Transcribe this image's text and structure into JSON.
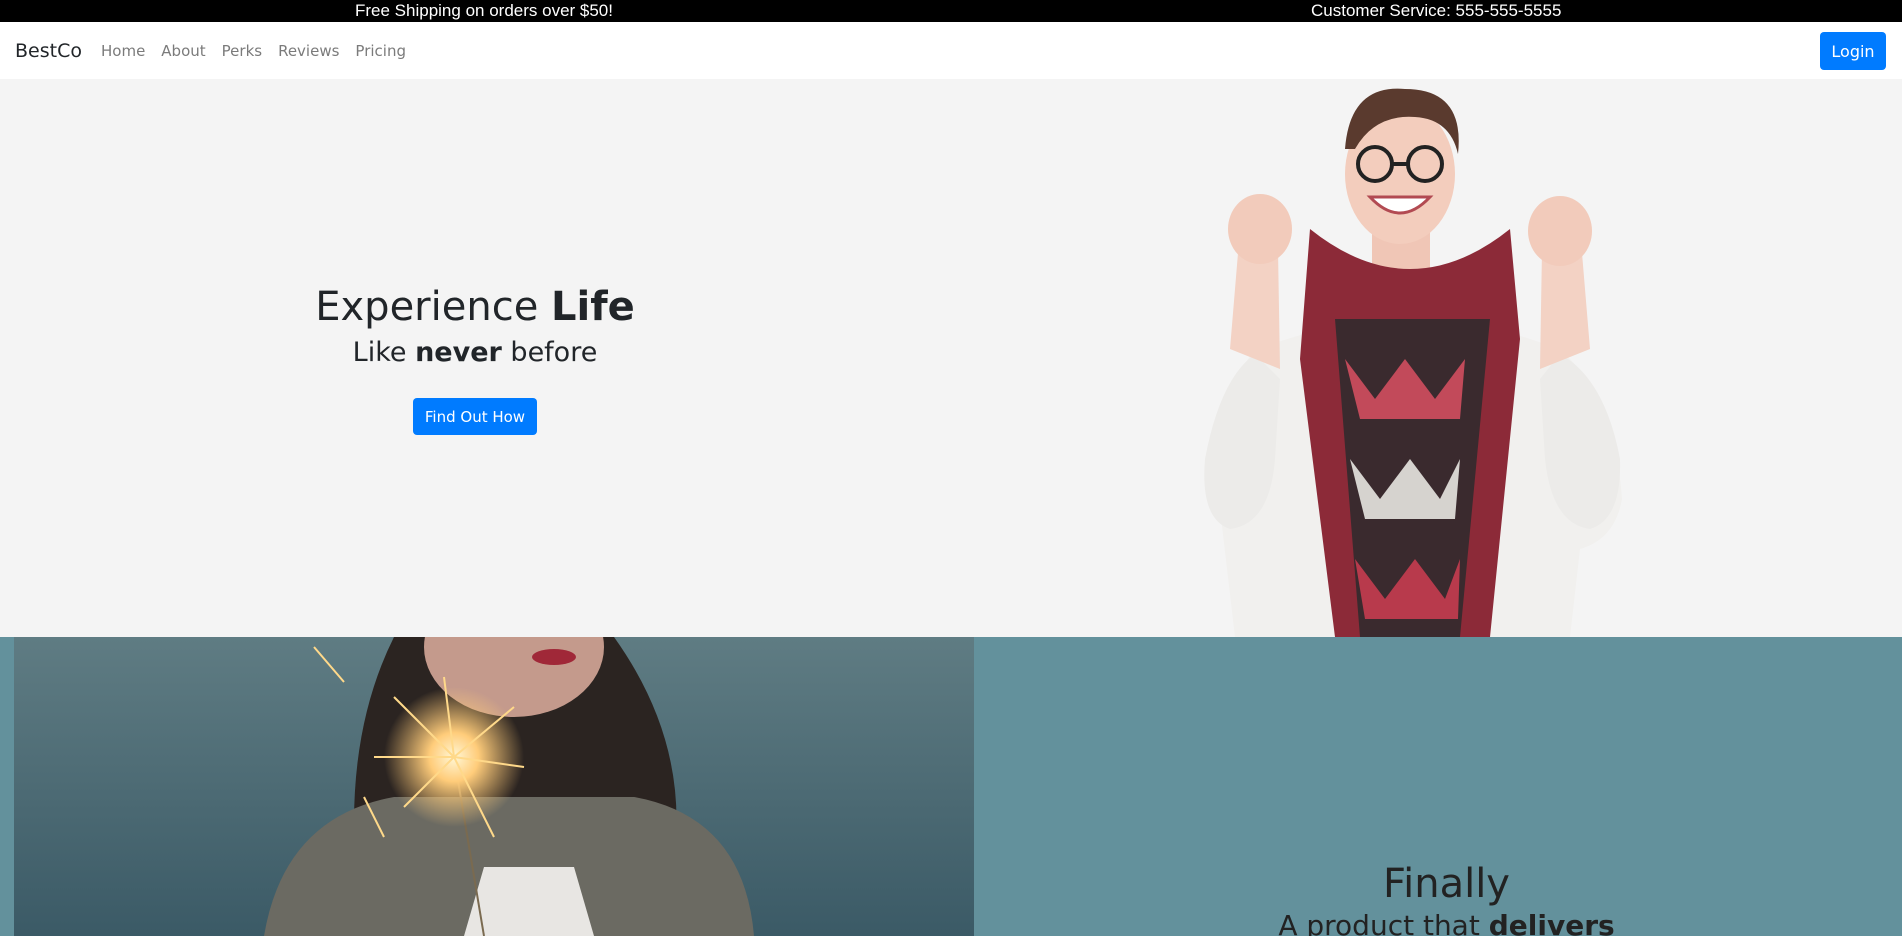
{
  "topbar": {
    "promo": "Free Shipping on orders over $50!",
    "service": "Customer Service: 555-555-5555"
  },
  "nav": {
    "brand": "BestCo",
    "links": [
      "Home",
      "About",
      "Perks",
      "Reviews",
      "Pricing"
    ],
    "login": "Login"
  },
  "hero": {
    "title_pre": "Experience ",
    "title_bold": "Life",
    "sub_pre": "Like ",
    "sub_bold": "never",
    "sub_post": " before",
    "cta": "Find Out How",
    "image": "smiling-woman-photo"
  },
  "feature": {
    "image": "sparkler-photo",
    "title": "Finally",
    "sub_pre": "A product that ",
    "sub_bold": "delivers"
  },
  "colors": {
    "accent": "#007bff",
    "hero_bg": "#f4f4f4",
    "feature_bg": "#63919c",
    "topbar_bg": "#000000"
  }
}
